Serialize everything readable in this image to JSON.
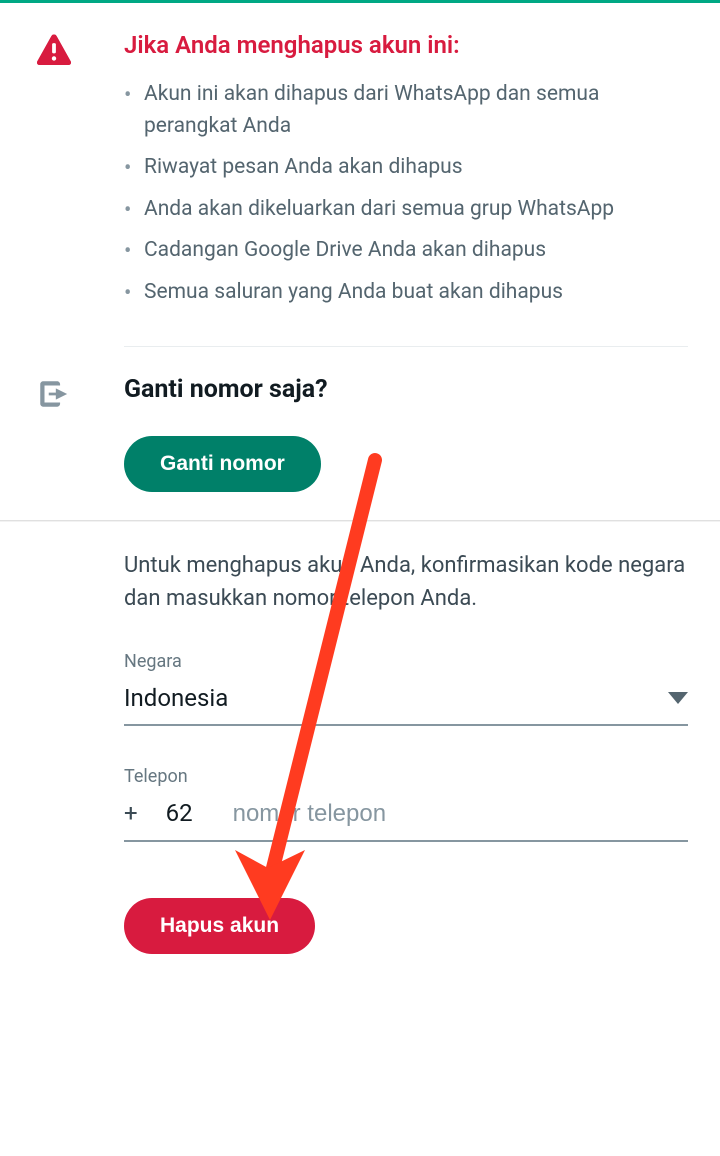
{
  "warning": {
    "title": "Jika Anda menghapus akun ini:",
    "items": [
      "Akun ini akan dihapus dari WhatsApp dan semua perangkat Anda",
      "Riwayat pesan Anda akan dihapus",
      "Anda akan dikeluarkan dari semua grup WhatsApp",
      "Cadangan Google Drive Anda akan dihapus",
      "Semua saluran yang Anda buat akan dihapus"
    ]
  },
  "change": {
    "title": "Ganti nomor saja?",
    "button": "Ganti nomor"
  },
  "form": {
    "instruction": "Untuk menghapus akun Anda, konfirmasikan kode negara dan masukkan nomor telepon Anda.",
    "country_label": "Negara",
    "country_value": "Indonesia",
    "phone_label": "Telepon",
    "plus": "+",
    "country_code": "62",
    "phone_placeholder": "nomor telepon",
    "delete_button": "Hapus akun"
  },
  "colors": {
    "accent_red": "#d81b3f",
    "accent_green": "#008069"
  }
}
